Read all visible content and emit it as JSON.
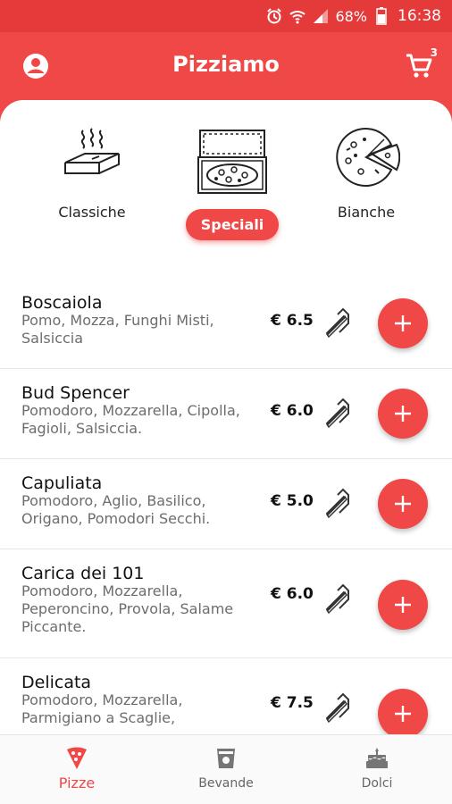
{
  "status_bar": {
    "battery": "68%",
    "time": "16:38",
    "icons": [
      "alarm-icon",
      "wifi-icon",
      "signal-icon",
      "battery-icon"
    ]
  },
  "app_bar": {
    "title": "Pizziamo",
    "cart_count": "3",
    "icons": [
      "profile-icon",
      "cart-icon"
    ]
  },
  "categories": [
    {
      "label": "Classiche",
      "icon": "pizza-box-closed-icon",
      "selected": false
    },
    {
      "label": "Speciali",
      "icon": "pizza-box-open-icon",
      "selected": true
    },
    {
      "label": "Bianche",
      "icon": "pizza-slice-icon",
      "selected": false
    }
  ],
  "pizzas": [
    {
      "name": "Boscaiola",
      "desc": "Pomo, Mozza, Funghi Misti, Salsiccia",
      "price": "€ 6.5"
    },
    {
      "name": "Bud Spencer",
      "desc": "Pomodoro, Mozzarella, Cipolla, Fagioli, Salsiccia.",
      "price": "€ 6.0"
    },
    {
      "name": "Capuliata",
      "desc": "Pomodoro, Aglio, Basilico, Origano, Pomodori Secchi.",
      "price": "€ 5.0"
    },
    {
      "name": "Carica dei 101",
      "desc": "Pomodoro, Mozzarella, Peperoncino, Provola, Salame Piccante.",
      "price": "€ 6.0"
    },
    {
      "name": "Delicata",
      "desc": "Pomodoro, Mozzarella, Parmigiano a Scaglie,",
      "price": "€ 7.5"
    }
  ],
  "bottom_nav": [
    {
      "label": "Pizze",
      "icon": "pizza-icon",
      "active": true
    },
    {
      "label": "Bevande",
      "icon": "drink-icon",
      "active": false
    },
    {
      "label": "Dolci",
      "icon": "cake-icon",
      "active": false
    }
  ],
  "colors": {
    "accent": "#f04747",
    "status_bar": "#e53a3a",
    "text_secondary": "#6d6d6d"
  }
}
